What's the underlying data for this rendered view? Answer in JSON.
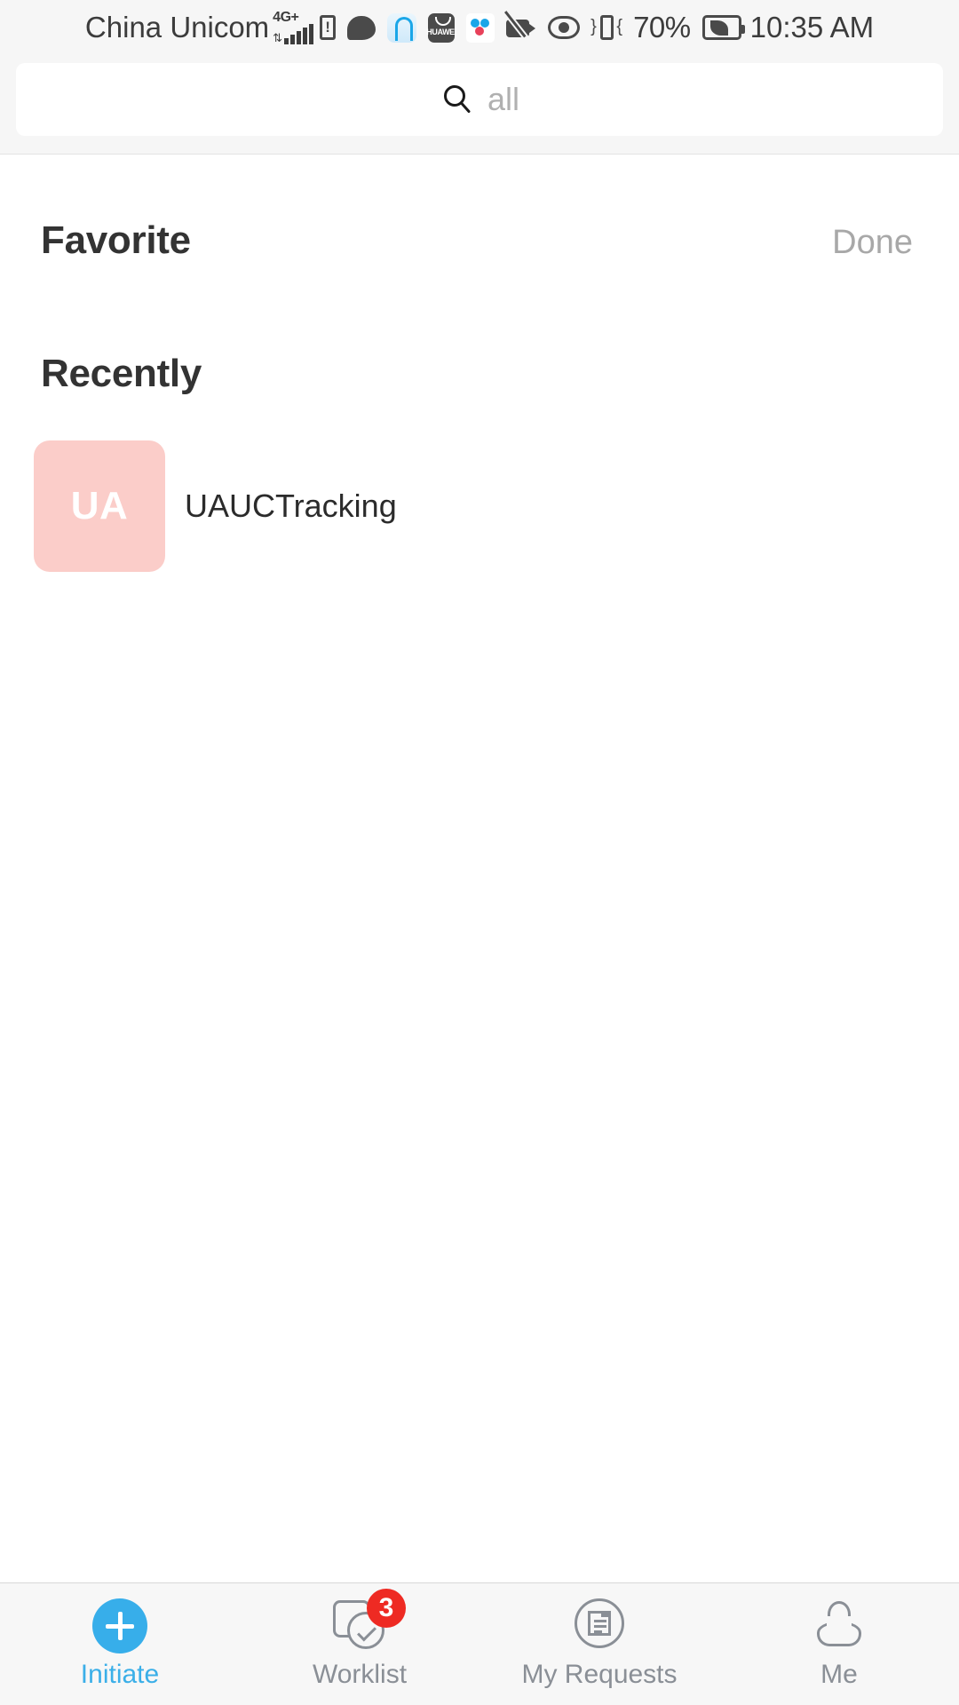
{
  "status_bar": {
    "carrier": "China Unicom",
    "network_label": "4G+",
    "battery_percent": "70%",
    "time": "10:35 AM",
    "icons": [
      "network-4g-signal-icon",
      "sim-alert-icon",
      "chat-bubble-icon",
      "browser-icon",
      "huawei-app-icon",
      "cloud-dots-icon",
      "camera-disabled-icon",
      "eye-comfort-icon",
      "vibrate-icon",
      "battery-saver-icon"
    ]
  },
  "search": {
    "placeholder": "all",
    "value": "",
    "icon": "search-icon"
  },
  "sections": {
    "favorite": {
      "title": "Favorite",
      "action_label": "Done",
      "items": []
    },
    "recently": {
      "title": "Recently",
      "items": [
        {
          "initials": "UA",
          "label": "UAUCTracking",
          "tile_color": "#fbcdc9",
          "initials_color": "#ffffff"
        }
      ]
    }
  },
  "tab_bar": {
    "active_color": "#3bafe8",
    "inactive_color": "#8a8f96",
    "badge_color": "#ee2a23",
    "items": [
      {
        "label": "Initiate",
        "icon": "plus-circle-icon",
        "active": true,
        "badge": ""
      },
      {
        "label": "Worklist",
        "icon": "task-check-icon",
        "active": false,
        "badge": "3"
      },
      {
        "label": "My Requests",
        "icon": "document-circle-icon",
        "active": false,
        "badge": ""
      },
      {
        "label": "Me",
        "icon": "person-icon",
        "active": false,
        "badge": ""
      }
    ]
  }
}
